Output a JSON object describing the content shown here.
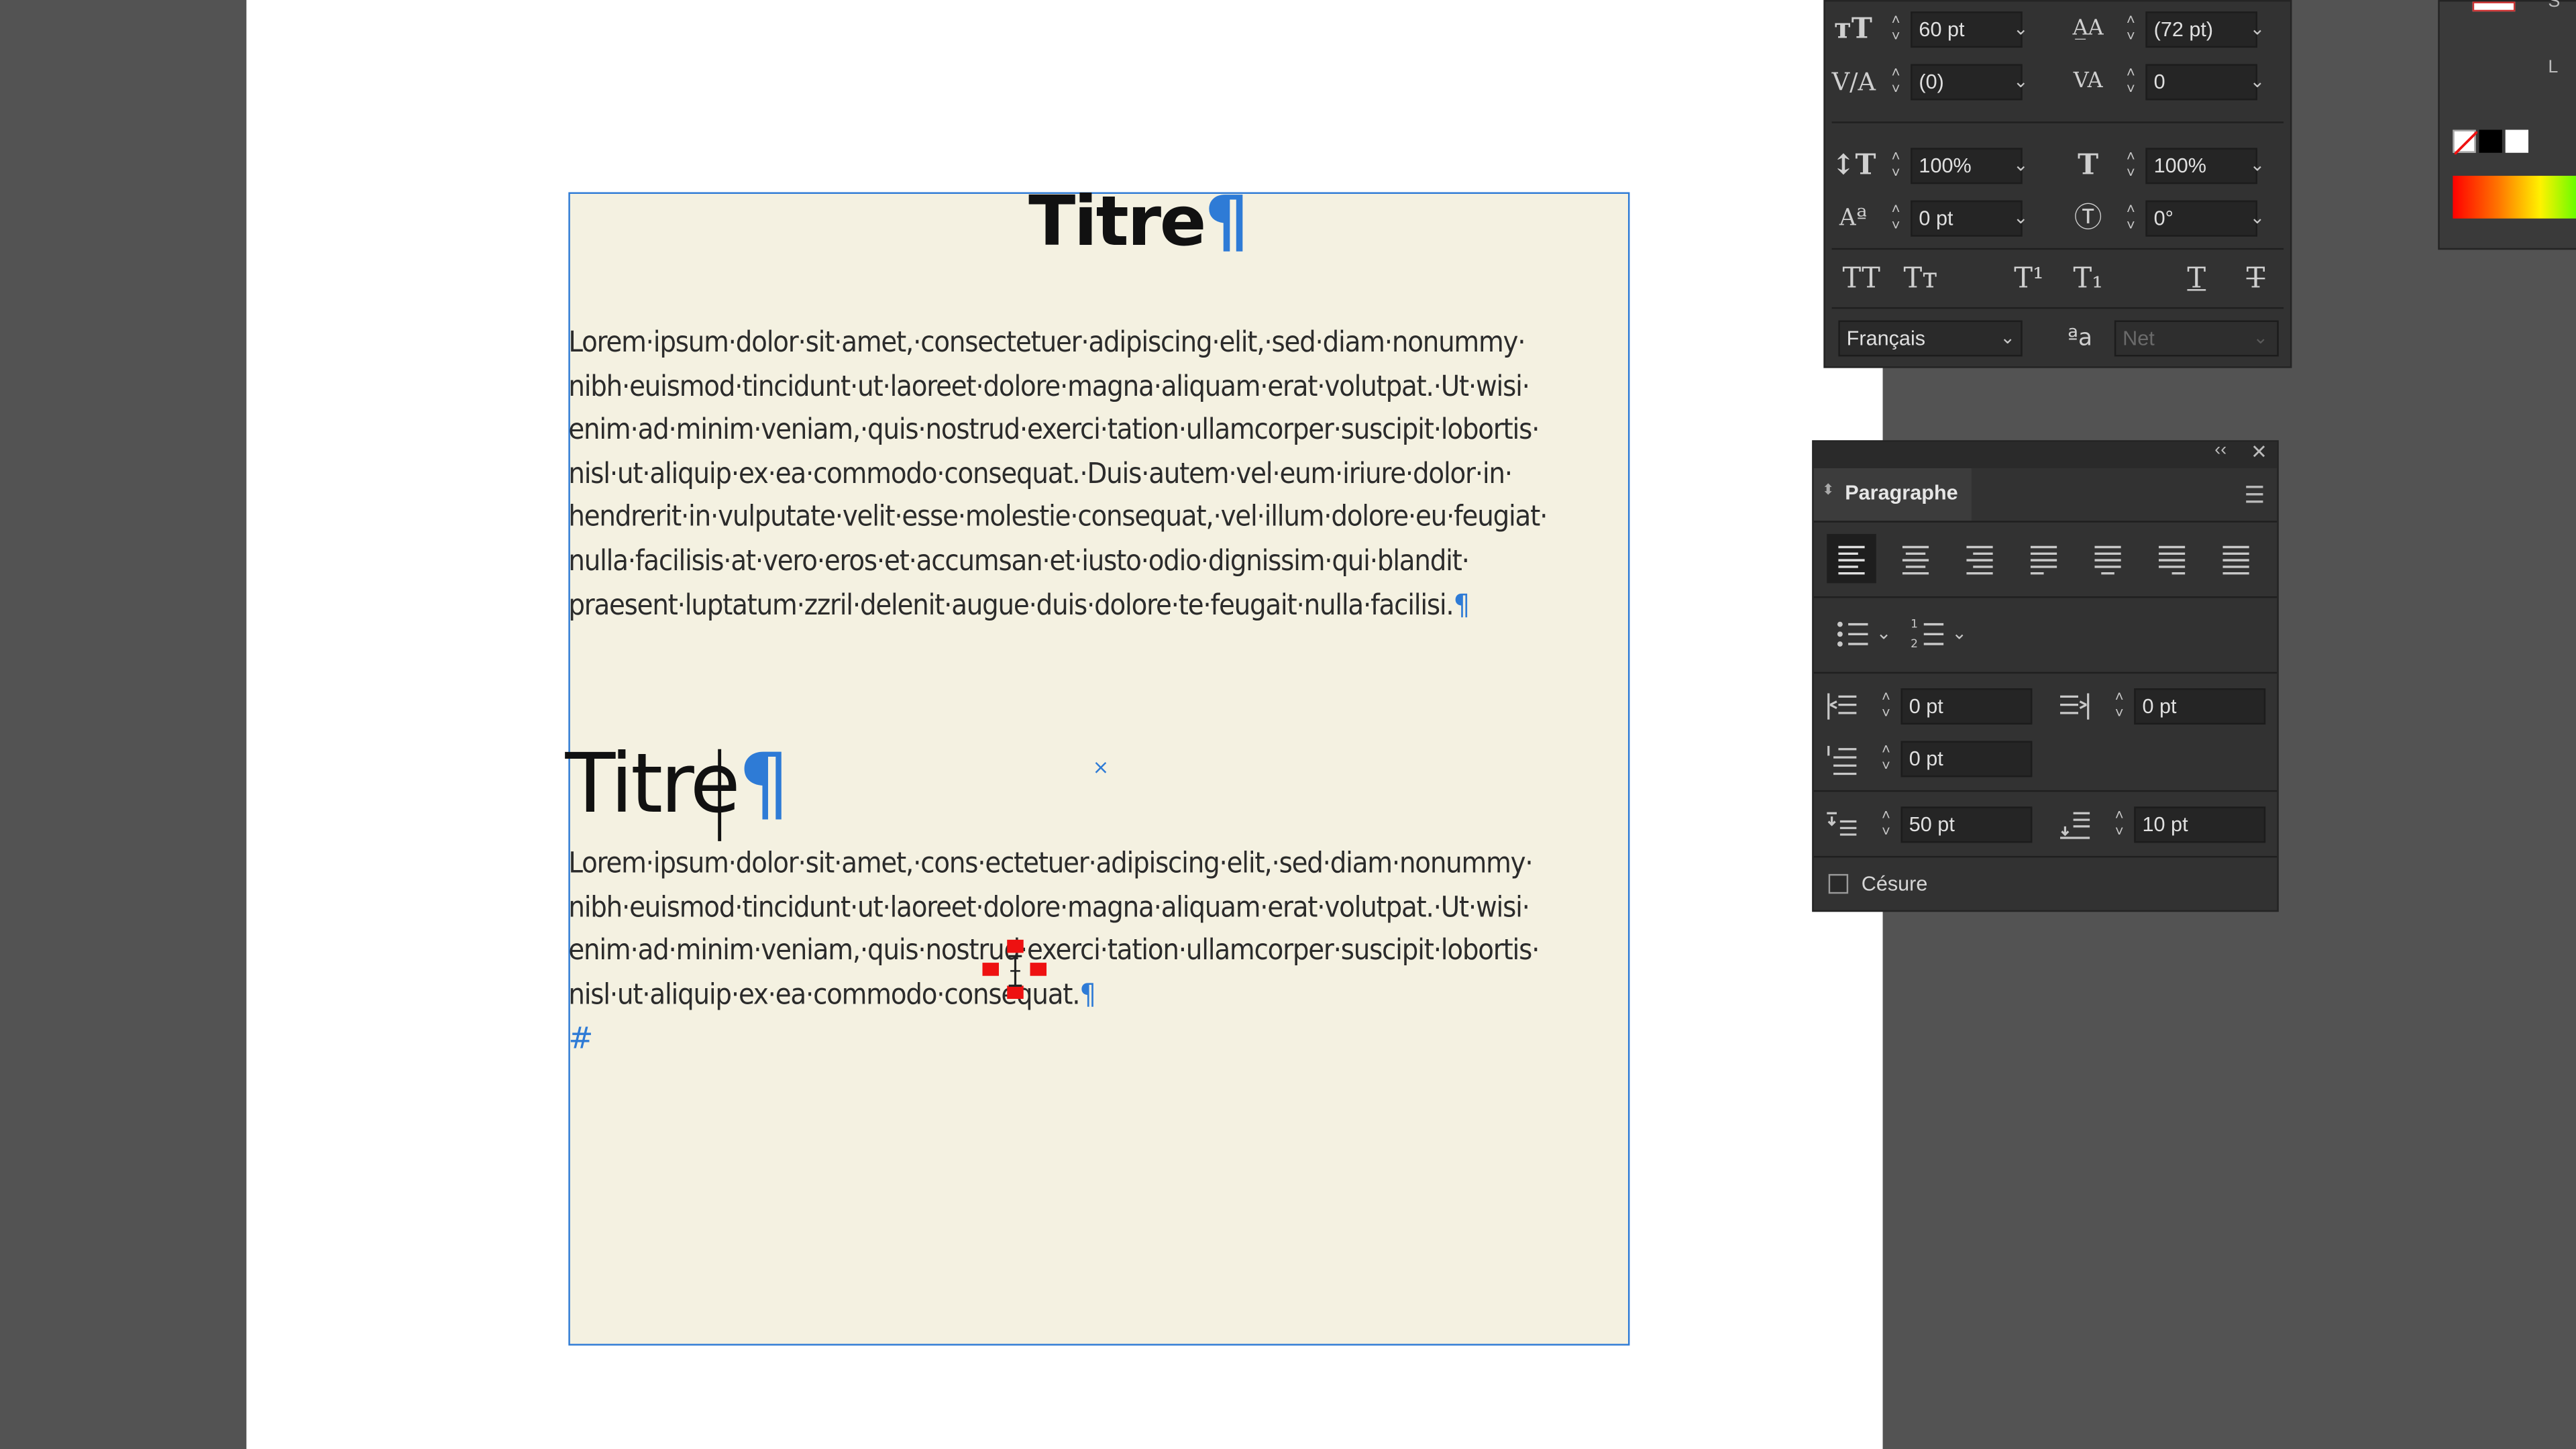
{
  "document": {
    "title_1": "Titre",
    "title_2": "Titre",
    "pilcrow": "¶",
    "end_mark": "#",
    "frame_mark": "×",
    "paragraph_1_lines": [
      "Lorem·ipsum·dolor·sit·amet,·consectetuer·adipiscing·elit,·sed·diam·nonummy·",
      "nibh·euismod·tincidunt·ut·laoreet·dolore·magna·aliquam·erat·volutpat.·Ut·wisi·",
      "enim·ad·minim·veniam,·quis·nostrud·exerci·tation·ullamcorper·suscipit·lobortis·",
      "nisl·ut·aliquip·ex·ea·commodo·consequat.·Duis·autem·vel·eum·iriure·dolor·in·",
      "hendrerit·in·vulputate·velit·esse·molestie·consequat,·vel·illum·dolore·eu·feugiat·",
      "nulla·facilisis·at·vero·eros·et·accumsan·et·iusto·odio·dignissim·qui·blandit·",
      "praesent·luptatum·zzril·delenit·augue·duis·dolore·te·feugait·nulla·facilisi."
    ],
    "paragraph_2_lines": [
      "Lorem·ipsum·dolor·sit·amet,·cons·ectetuer·adipiscing·elit,·sed·diam·nonummy·",
      "nibh·euismod·tincidunt·ut·laoreet·dolore·magna·aliquam·erat·volutpat.·Ut·wisi·",
      "enim·ad·minim·veniam,·quis·nostrud·exerci·tation·ullamcorper·suscipit·lobortis·",
      "nisl·ut·aliquip·ex·ea·commodo·consequat."
    ]
  },
  "character_panel": {
    "font_size": "60 pt",
    "leading": "(72 pt)",
    "kerning": "(0)",
    "tracking": "0",
    "vertical_scale": "100%",
    "horizontal_scale": "100%",
    "baseline_shift": "0 pt",
    "skew": "0°",
    "language": "Français",
    "hyphenation_style": "Net",
    "style_buttons": [
      "TT",
      "Tт",
      "T¹",
      "T₁",
      "T",
      "T"
    ]
  },
  "paragraph_panel": {
    "title": "Paragraphe",
    "left_indent": "0 pt",
    "right_indent": "0 pt",
    "first_line_indent": "0 pt",
    "space_before": "50 pt",
    "space_after": "10 pt",
    "hyphenate_label": "Césure",
    "hyphenate_checked": false
  },
  "swatches_panel": {
    "letter_s": "S",
    "letter_l": "L"
  },
  "colors": {
    "accent": "#2e7bd6",
    "frame_fill": "#f4f1e1",
    "panel_bg": "#323232",
    "pasteboard": "#535353"
  }
}
